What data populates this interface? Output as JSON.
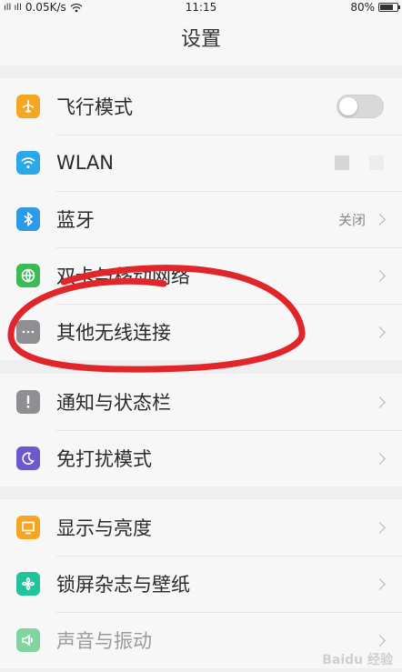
{
  "status_bar": {
    "signal": "ıll ıll",
    "net_speed": "0.05K/s",
    "time": "11:15",
    "battery": "80%",
    "battery_level": 0.8
  },
  "header": {
    "title": "设置"
  },
  "groups": [
    {
      "items": [
        {
          "label": "飞行模式",
          "icon": "airplane-icon",
          "color": "#f5a623",
          "control": "toggle",
          "toggle_on": false
        },
        {
          "label": "WLAN",
          "icon": "wifi-icon",
          "color": "#2aa8e8",
          "control": "none"
        },
        {
          "label": "蓝牙",
          "icon": "bluetooth-icon",
          "color": "#2b9ae8",
          "value": "关闭",
          "control": "chevron"
        },
        {
          "label": "双卡与移动网络",
          "icon": "globe-icon",
          "color": "#3cba54",
          "control": "chevron"
        },
        {
          "label": "其他无线连接",
          "icon": "more-dots-icon",
          "color": "#8e8e93",
          "control": "chevron"
        }
      ]
    },
    {
      "items": [
        {
          "label": "通知与状态栏",
          "icon": "exclamation-icon",
          "color": "#8e8e93",
          "control": "chevron"
        },
        {
          "label": "免打扰模式",
          "icon": "moon-icon",
          "color": "#6a5acd",
          "control": "chevron"
        }
      ]
    },
    {
      "items": [
        {
          "label": "显示与亮度",
          "icon": "display-icon",
          "color": "#f5a623",
          "control": "chevron"
        },
        {
          "label": "锁屏杂志与壁纸",
          "icon": "flower-icon",
          "color": "#21c39a",
          "control": "chevron"
        },
        {
          "label": "声音与振动",
          "icon": "speaker-icon",
          "color": "#7fd4a0",
          "control": "chevron"
        }
      ]
    }
  ],
  "watermark": "Baidu 经验",
  "annotation_color": "#e0262b"
}
